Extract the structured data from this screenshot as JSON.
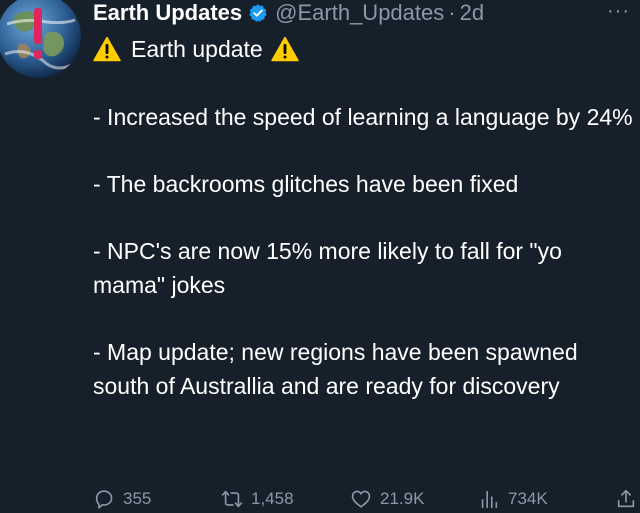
{
  "author": {
    "display_name": "Earth Updates",
    "handle": "@Earth_Updates",
    "separator": "·",
    "time": "2d",
    "avatar_icon": "earth-globe-icon",
    "verified_icon": "verified-badge-icon",
    "more_label": "···"
  },
  "tweet": {
    "title": "Earth update",
    "title_icon": "warning-icon",
    "paragraphs": [
      "- Increased the speed of learning a language by 24%",
      "- The backrooms glitches have been fixed",
      "- NPC's are now 15% more likely to fall for \"yo mama\" jokes",
      "- Map update; new regions have been spawned south of Australlia and are ready for discovery"
    ]
  },
  "actions": {
    "replies": "355",
    "retweets": "1,458",
    "likes": "21.9K",
    "views": "734K"
  },
  "colors": {
    "background": "#15202b",
    "text": "#ffffff",
    "muted": "#8b98a5",
    "verified": "#1d9bf0",
    "warning": "#ffcc00"
  }
}
